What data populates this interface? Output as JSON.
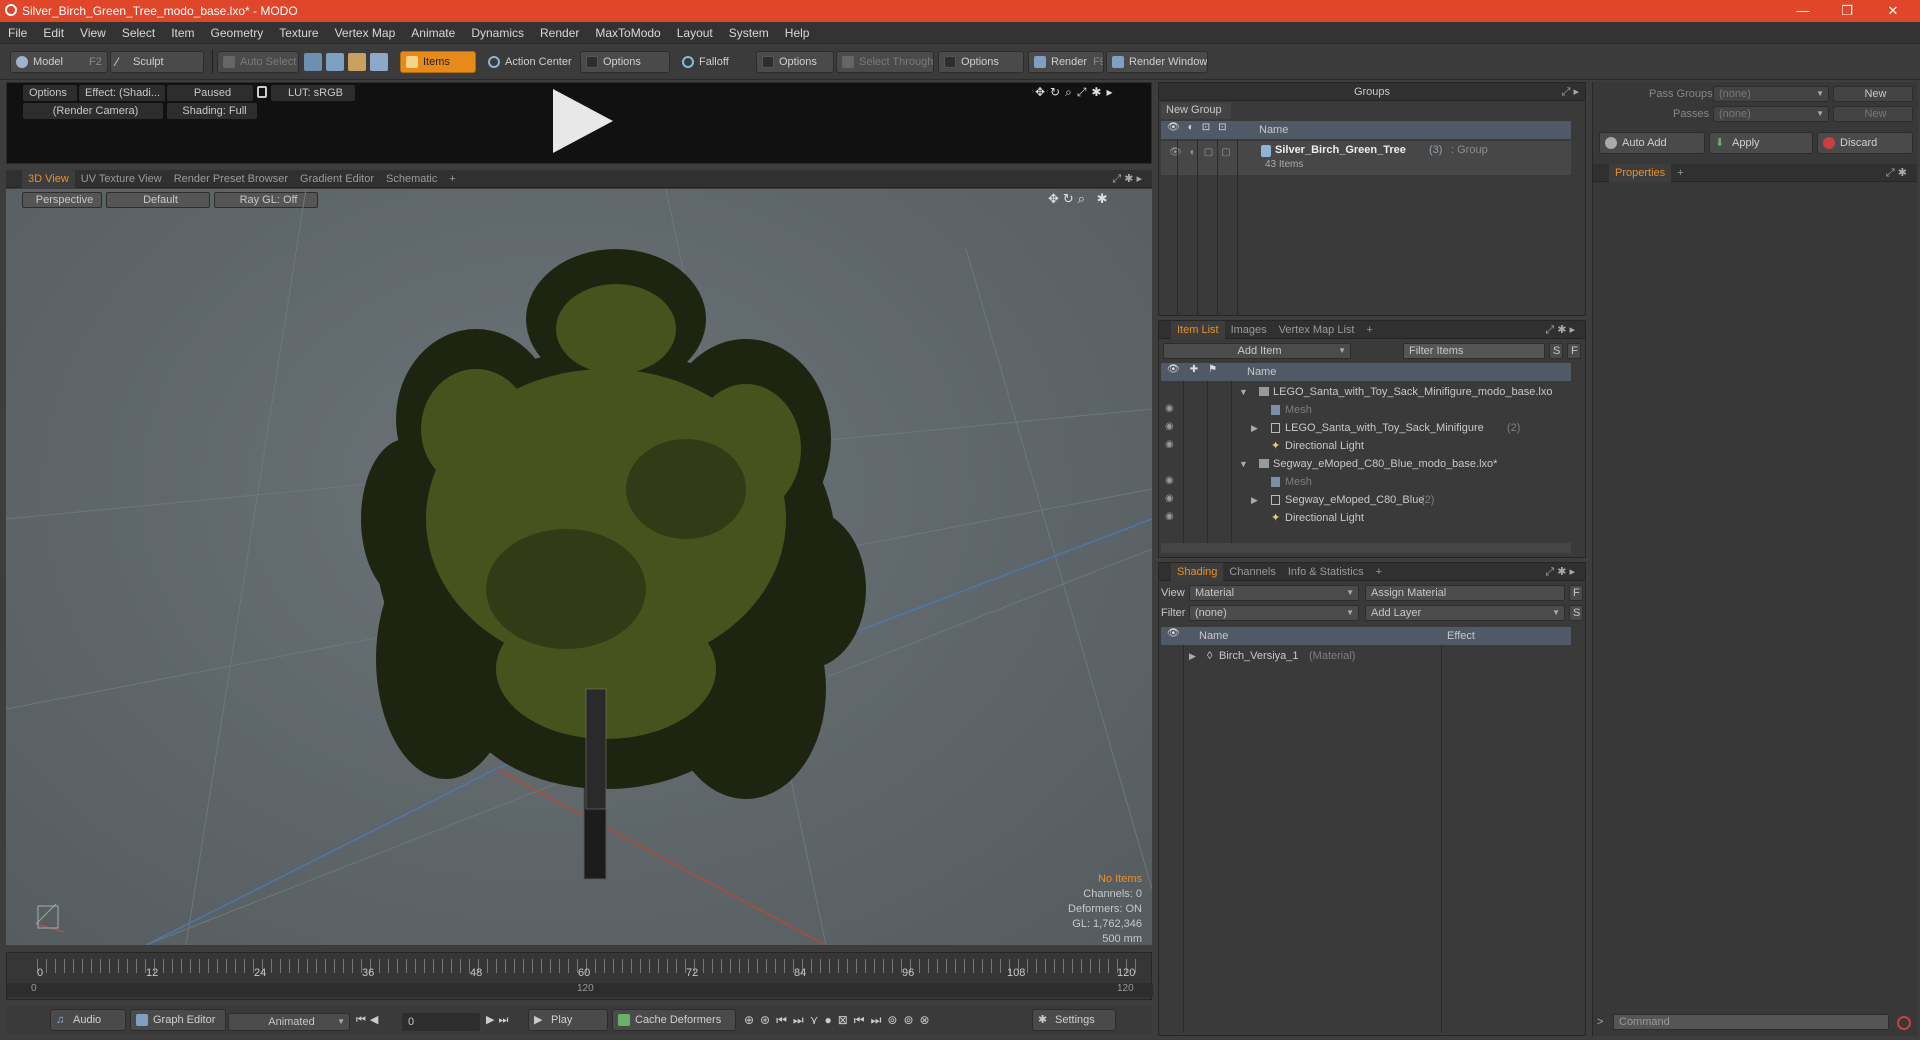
{
  "window": {
    "title": "Silver_Birch_Green_Tree_modo_base.lxo* - MODO",
    "minimize": "—",
    "restore": "❐",
    "close": "✕"
  },
  "menu": [
    "File",
    "Edit",
    "View",
    "Select",
    "Item",
    "Geometry",
    "Texture",
    "Vertex Map",
    "Animate",
    "Dynamics",
    "Render",
    "MaxToModo",
    "Layout",
    "System",
    "Help"
  ],
  "toolbar": {
    "model": "Model",
    "model_key": "F2",
    "sculpt": "Sculpt",
    "auto_select": "Auto Select",
    "items": "Items",
    "action_center": "Action Center",
    "options1": "Options",
    "falloff": "Falloff",
    "options2": "Options",
    "select_through": "Select Through",
    "options3": "Options",
    "render": "Render",
    "render_key": "F9",
    "render_window": "Render Window"
  },
  "preview": {
    "options": "Options",
    "effect": "Effect: (Shadi...",
    "paused": "Paused",
    "lut": "LUT: sRGB",
    "camera": "(Render Camera)",
    "shading": "Shading: Full"
  },
  "viewport_tabs": [
    "3D View",
    "UV Texture View",
    "Render Preset Browser",
    "Gradient Editor",
    "Schematic",
    "+"
  ],
  "viewport": {
    "perspective": "Perspective",
    "default": "Default",
    "raygl": "Ray GL: Off",
    "info": {
      "no_items": "No Items",
      "channels": "Channels: 0",
      "deformers": "Deformers: ON",
      "gl": "GL: 1,762,346",
      "scale": "500 mm"
    }
  },
  "timeline": {
    "ticks": [
      "0",
      "12",
      "24",
      "36",
      "48",
      "60",
      "72",
      "84",
      "96",
      "108",
      "120"
    ],
    "end_top": "120",
    "end_bottom": "120",
    "start": "0"
  },
  "bottombar": {
    "audio": "Audio",
    "graph_editor": "Graph Editor",
    "animated": "Animated",
    "frame": "0",
    "play": "Play",
    "cache": "Cache Deformers",
    "settings": "Settings"
  },
  "groups": {
    "title": "Groups",
    "new_group": "New Group",
    "col_name": "Name",
    "item": "Silver_Birch_Green_Tree",
    "item_count": "(3)",
    "item_type": ": Group",
    "sub": "43 Items"
  },
  "item_list": {
    "tabs": [
      "Item List",
      "Images",
      "Vertex Map List",
      "+"
    ],
    "add_item": "Add Item",
    "filter": "Filter Items",
    "s": "S",
    "f": "F",
    "col_name": "Name",
    "rows": [
      {
        "label": "LEGO_Santa_with_Toy_Sack_Minifigure_modo_base.lxo",
        "count": "",
        "dim": false
      },
      {
        "label": "Mesh",
        "count": "",
        "dim": true
      },
      {
        "label": "LEGO_Santa_with_Toy_Sack_Minifigure",
        "count": "(2)",
        "dim": false
      },
      {
        "label": "Directional Light",
        "count": "",
        "dim": false
      },
      {
        "label": "Segway_eMoped_C80_Blue_modo_base.lxo*",
        "count": "",
        "dim": false
      },
      {
        "label": "Mesh",
        "count": "",
        "dim": true
      },
      {
        "label": "Segway_eMoped_C80_Blue",
        "count": "(2)",
        "dim": false
      },
      {
        "label": "Directional Light",
        "count": "",
        "dim": false
      }
    ]
  },
  "shading": {
    "tabs": [
      "Shading",
      "Channels",
      "Info & Statistics",
      "+"
    ],
    "view_label": "View",
    "view_value": "Material",
    "assign": "Assign Material",
    "f": "F",
    "filter_label": "Filter",
    "filter_value": "(none)",
    "add_layer": "Add Layer",
    "s": "S",
    "col_name": "Name",
    "col_effect": "Effect",
    "row": "Birch_Versiya_1",
    "row_type": "(Material)"
  },
  "right": {
    "pass_groups": "Pass Groups",
    "pass_groups_val": "(none)",
    "new": "New",
    "passes": "Passes",
    "passes_val": "(none)",
    "new2": "New",
    "auto_add": "Auto Add",
    "apply": "Apply",
    "discard": "Discard",
    "properties": "Properties",
    "plus": "+",
    "command": "Command"
  },
  "colors": {
    "accent": "#e8912a",
    "title": "#e0462a"
  }
}
